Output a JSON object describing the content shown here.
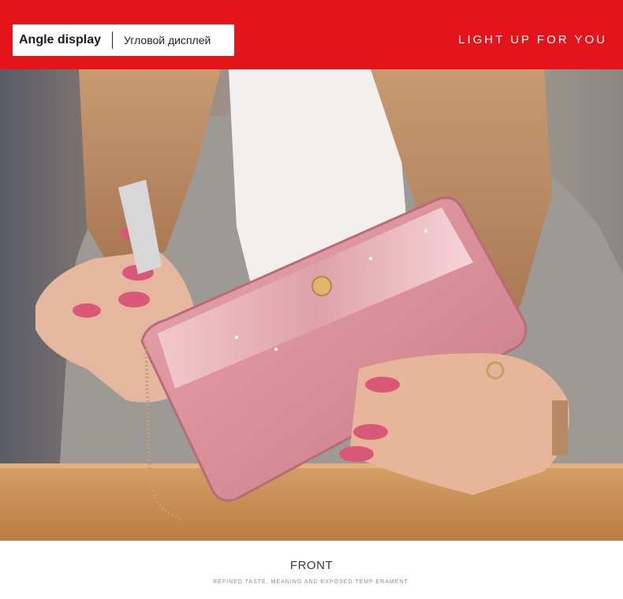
{
  "banner": {
    "title_en": "Angle display",
    "title_ru": "Угловой дисплей",
    "tagline": "LIGHT UP FOR YOU",
    "accent_color": "#e5141b"
  },
  "photo": {
    "subject": "pink-glitter-wallet-icon"
  },
  "footer": {
    "caption": "FRONT",
    "subcaption": "REFINED TASTE, MEANING AND EXPOSED TEMP ERAMENT."
  }
}
